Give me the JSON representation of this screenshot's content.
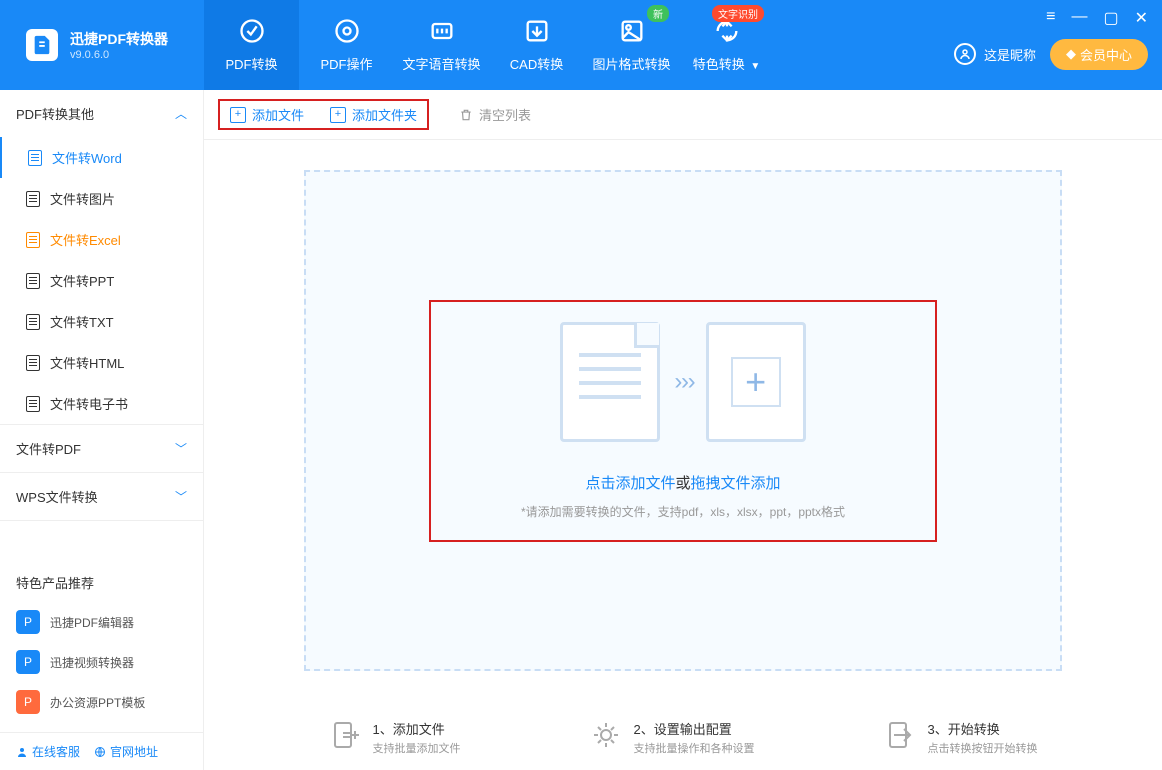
{
  "app": {
    "name": "迅捷PDF转换器",
    "version": "v9.0.6.0"
  },
  "nav": [
    {
      "label": "PDF转换",
      "active": true
    },
    {
      "label": "PDF操作"
    },
    {
      "label": "文字语音转换"
    },
    {
      "label": "CAD转换"
    },
    {
      "label": "图片格式转换",
      "badge": "新",
      "badge_class": "green"
    },
    {
      "label": "特色转换",
      "badge": "文字识别",
      "badge_class": "red",
      "caret": true
    }
  ],
  "user": {
    "name": "这是昵称",
    "vip": "会员中心"
  },
  "sidebar": {
    "sections": [
      {
        "title": "PDF转换其他",
        "open": true,
        "items": [
          {
            "label": "文件转Word",
            "active": true
          },
          {
            "label": "文件转图片"
          },
          {
            "label": "文件转Excel",
            "highlight": true
          },
          {
            "label": "文件转PPT"
          },
          {
            "label": "文件转TXT"
          },
          {
            "label": "文件转HTML"
          },
          {
            "label": "文件转电子书"
          }
        ]
      },
      {
        "title": "文件转PDF",
        "open": false
      },
      {
        "title": "WPS文件转换",
        "open": false
      }
    ],
    "recommend_title": "特色产品推荐",
    "recommend": [
      {
        "label": "迅捷PDF编辑器",
        "color": "#1989f7"
      },
      {
        "label": "迅捷视频转换器",
        "color": "#1989f7"
      },
      {
        "label": "办公资源PPT模板",
        "color": "#ff6a3d"
      }
    ],
    "footer": {
      "service": "在线客服",
      "site": "官网地址"
    }
  },
  "toolbar": {
    "add_file": "添加文件",
    "add_folder": "添加文件夹",
    "clear": "清空列表"
  },
  "dropzone": {
    "line1a": "点击添加文件",
    "line1b": "或",
    "line1c": "拖拽文件添加",
    "line2": "*请添加需要转换的文件，支持pdf，xls，xlsx，ppt，pptx格式"
  },
  "steps": [
    {
      "title": "1、添加文件",
      "sub": "支持批量添加文件"
    },
    {
      "title": "2、设置输出配置",
      "sub": "支持批量操作和各种设置"
    },
    {
      "title": "3、开始转换",
      "sub": "点击转换按钮开始转换"
    }
  ]
}
